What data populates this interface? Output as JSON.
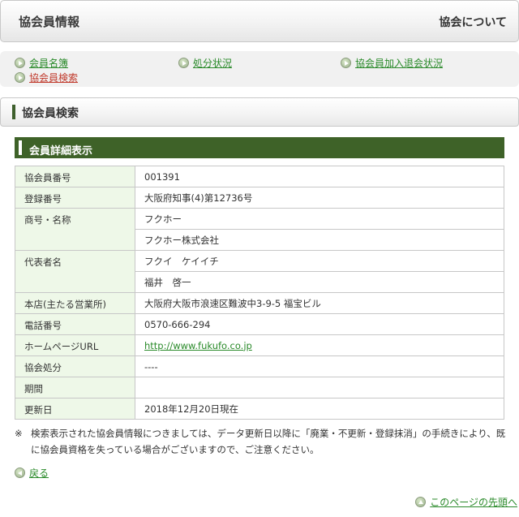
{
  "header": {
    "title": "協会員情報",
    "about": "協会について"
  },
  "nav": {
    "items": [
      {
        "label": "会員名簿"
      },
      {
        "label": "処分状況"
      },
      {
        "label": "協会員加入退会状況"
      },
      {
        "label": "協会員検索"
      }
    ]
  },
  "section": {
    "title": "協会員検索"
  },
  "detail": {
    "heading": "会員詳細表示",
    "rows": {
      "member_no": {
        "label": "協会員番号",
        "value": "001391"
      },
      "reg_no": {
        "label": "登録番号",
        "value": "大阪府知事(4)第12736号"
      },
      "name": {
        "label": "商号・名称",
        "kana": "フクホー",
        "value": "フクホー株式会社"
      },
      "rep": {
        "label": "代表者名",
        "kana": "フクイ　ケイイチ",
        "value": "福井　啓一"
      },
      "office": {
        "label": "本店(主たる営業所)",
        "value": "大阪府大阪市浪速区難波中3-9-5 福宝ビル"
      },
      "phone": {
        "label": "電話番号",
        "value": "0570-666-294"
      },
      "homepage": {
        "label": "ホームページURL",
        "value": "http://www.fukufo.co.jp"
      },
      "disposal": {
        "label": "協会処分",
        "value": "----"
      },
      "period": {
        "label": "期間",
        "value": ""
      },
      "updated": {
        "label": "更新日",
        "value": "2018年12月20日現在"
      }
    }
  },
  "note": {
    "mark": "※",
    "text": "検索表示された協会員情報につきましては、データ更新日以降に「廃業・不更新・登録抹消」の手続きにより、既に協会員資格を失っている場合がございますので、ご注意ください。"
  },
  "back": {
    "label": "戻る"
  },
  "totop": {
    "label": "このページの先頭へ"
  },
  "colors": {
    "accent": "#3e6228",
    "link": "#2a8a2a",
    "active_link": "#c0392b",
    "row_label_bg": "#eef8e8"
  },
  "icons": {
    "nav": "circle-arrow-right-icon",
    "back": "circle-arrow-left-icon",
    "top": "circle-arrow-up-icon"
  }
}
